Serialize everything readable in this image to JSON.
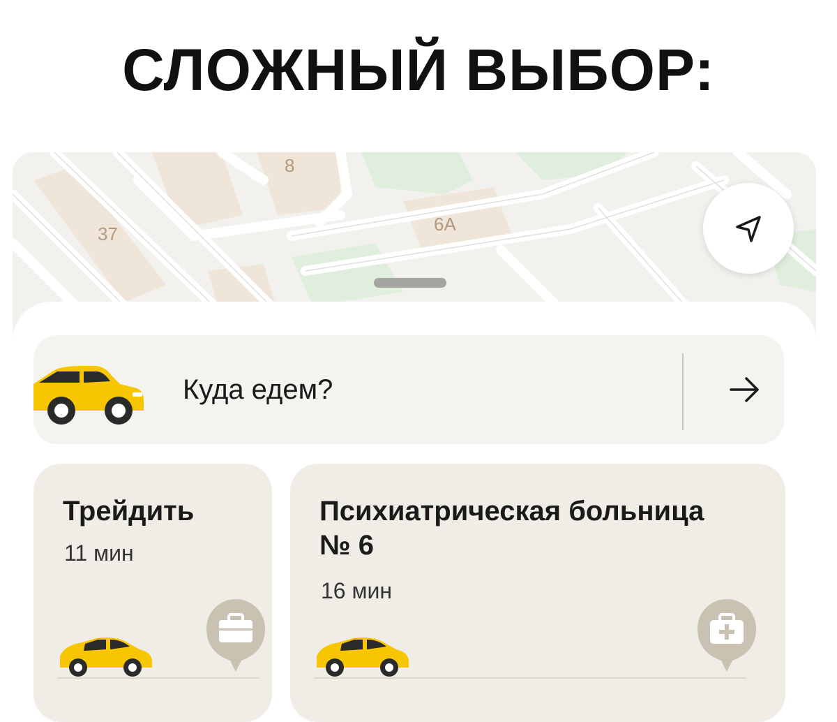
{
  "headline": "СЛОЖНЫЙ ВЫБОР:",
  "map": {
    "building_labels": [
      "8",
      "37",
      "6А"
    ]
  },
  "search": {
    "placeholder": "Куда едем?"
  },
  "destinations": [
    {
      "title": "Трейдить",
      "eta": "11 мин",
      "icon": "briefcase-icon"
    },
    {
      "title_line1": "Психиатрическая больница",
      "title_line2": "№ 6",
      "eta": "16 мин",
      "icon": "medkit-icon"
    }
  ],
  "colors": {
    "taxi_yellow": "#f7c600",
    "card_bg": "#f0ede6",
    "map_bg": "#f2f1ee",
    "pin_gray": "#c9c2b3"
  }
}
